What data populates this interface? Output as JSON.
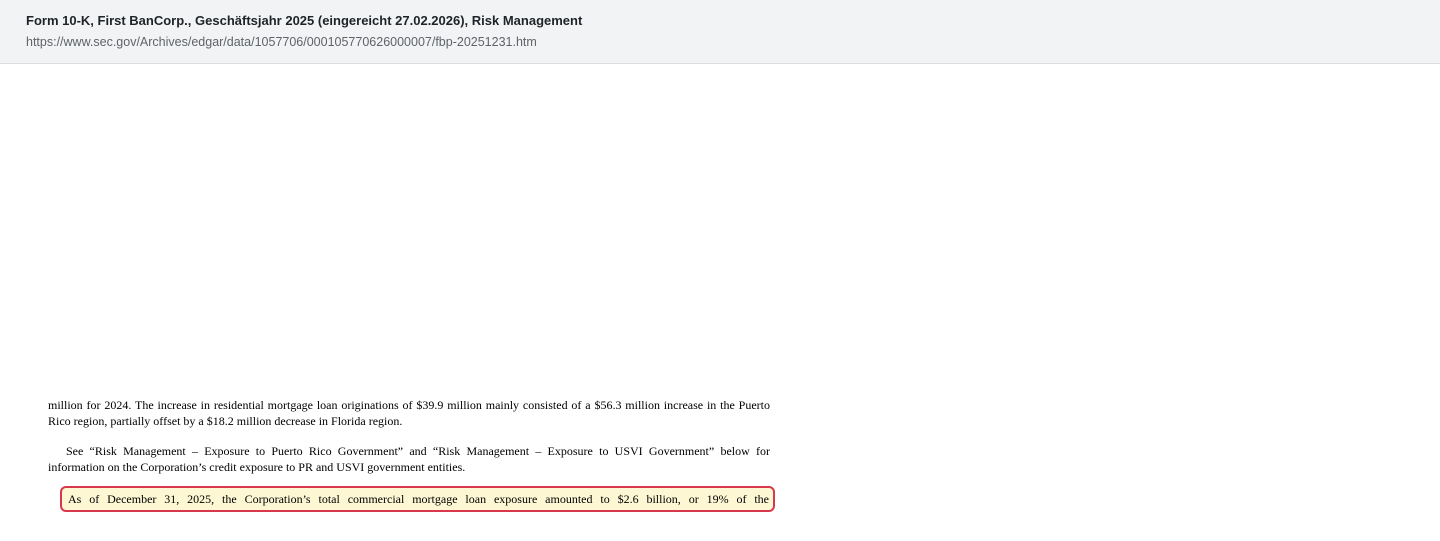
{
  "header": {
    "title": "Form 10-K, First BanCorp., Geschäftsjahr 2025 (eingereicht 27.02.2026), Risk Management",
    "url": "https://www.sec.gov/Archives/edgar/data/1057706/000105770626000007/fbp-20251231.htm"
  },
  "document": {
    "paragraphs": [
      "million for 2024. The increase in residential mortgage loan originations of $39.9 million mainly consisted of a $56.3 million increase in the Puerto Rico region, partially offset by a $18.2 million decrease in Florida region.",
      "See “Risk Management – Exposure to Puerto Rico Government” and “Risk Management – Exposure to USVI Government” below for information on the Corporation’s credit exposure to PR and USVI government entities."
    ],
    "highlighted": "As of December 31, 2025, the Corporation’s total commercial mortgage loan exposure amounted to $2.6 billion, or 19% of the"
  },
  "colors": {
    "highlight_border": "#d9374b",
    "highlight_fill": "#fdf7d3"
  }
}
